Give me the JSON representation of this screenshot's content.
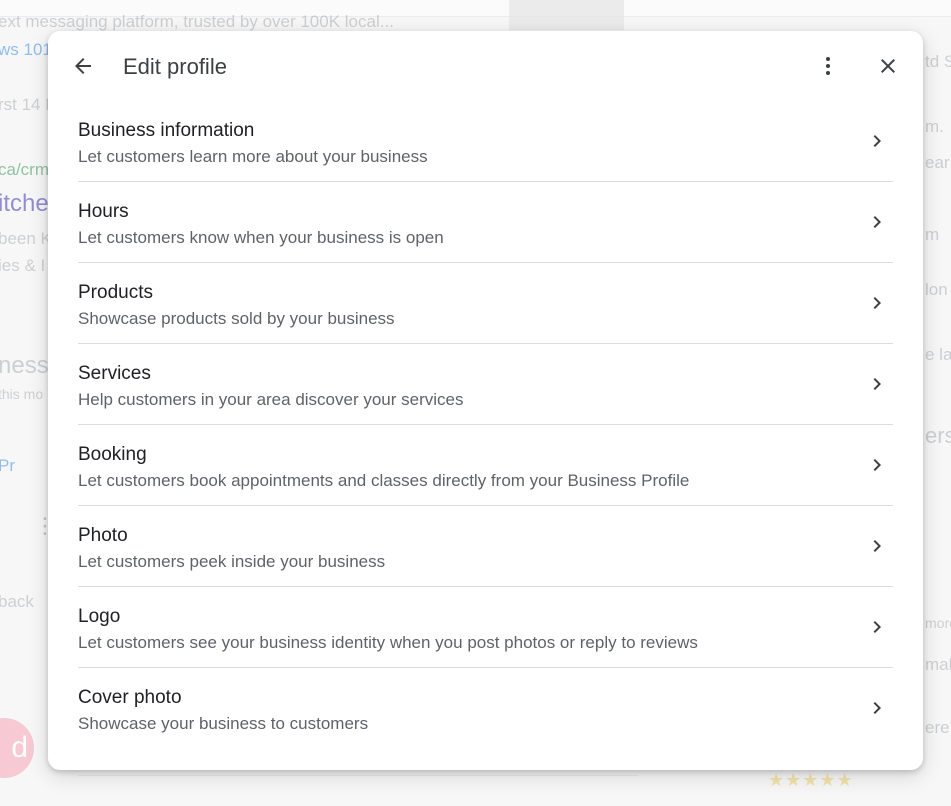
{
  "dialog": {
    "title": "Edit profile",
    "icons": {
      "back": "arrow-back-icon",
      "more": "more-vert-icon",
      "close": "close-icon",
      "chevron": "chevron-right-icon"
    },
    "items": [
      {
        "title": "Business information",
        "description": "Let customers learn more about your business"
      },
      {
        "title": "Hours",
        "description": "Let customers know when your business is open"
      },
      {
        "title": "Products",
        "description": "Showcase products sold by your business"
      },
      {
        "title": "Services",
        "description": "Help customers in your area discover your services"
      },
      {
        "title": "Booking",
        "description": "Let customers book appointments and classes directly from your Business Profile"
      },
      {
        "title": "Photo",
        "description": "Let customers peek inside your business"
      },
      {
        "title": "Logo",
        "description": "Let customers see your business identity when you post photos or reply to reviews"
      },
      {
        "title": "Cover photo",
        "description": "Showcase your business to customers"
      }
    ]
  },
  "background": {
    "fragments": [
      "ext messaging platform, trusted by over 100K local...",
      "ws 101",
      "rst 14 D",
      "ca/crm",
      "itche",
      "been K",
      "ies & I",
      "ness",
      "this mo",
      "Pr",
      "back",
      "d",
      "td S",
      "m.",
      "ear",
      "m",
      "lon",
      "e la",
      "ers",
      "more",
      "mal",
      "ere,"
    ],
    "stars": "★★★★★"
  },
  "colors": {
    "title_text": "#202124",
    "secondary_text": "#5f6368",
    "divider": "#dadce0",
    "icon": "#3c4043"
  }
}
